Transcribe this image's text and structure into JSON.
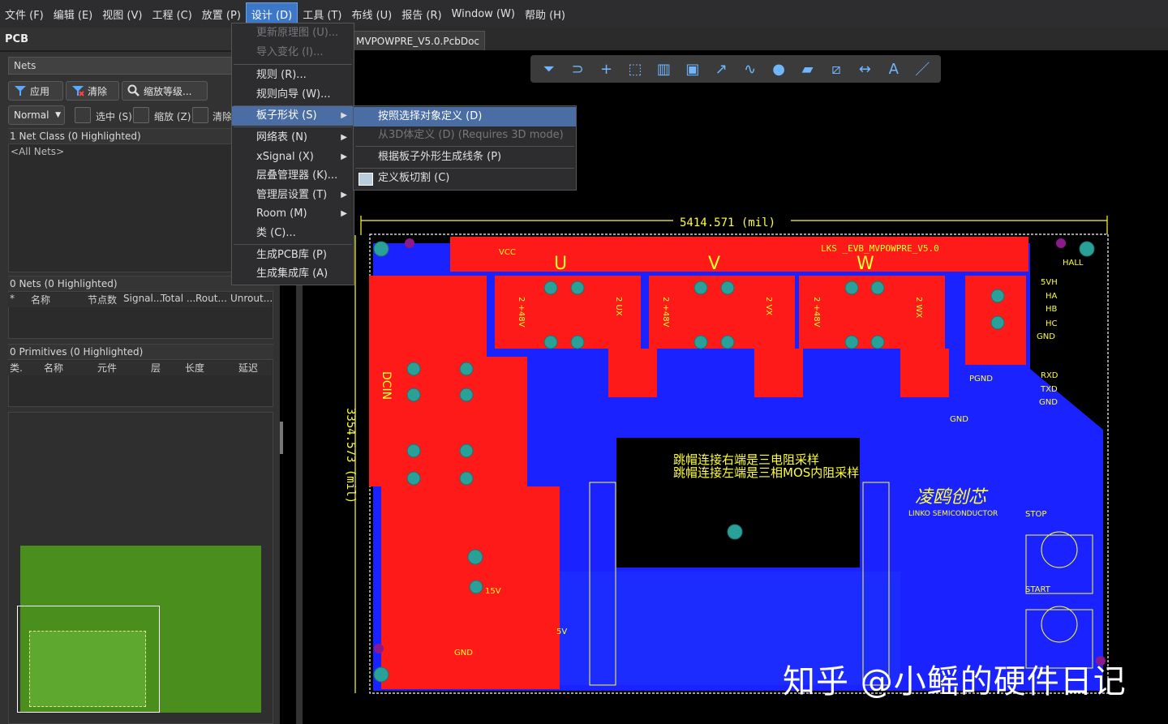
{
  "menubar": {
    "items": [
      "文件 (F)",
      "编辑 (E)",
      "视图 (V)",
      "工程 (C)",
      "放置 (P)",
      "设计 (D)",
      "工具 (T)",
      "布线 (U)",
      "报告 (R)",
      "Window (W)",
      "帮助 (H)"
    ]
  },
  "panel": {
    "title": "PCB",
    "nets_dropdown": "Nets",
    "apply": "应用",
    "clear": "清除",
    "zoom_level": "缩放等级...",
    "mode": "Normal",
    "select": "选中 (S)",
    "zoom": "缩放 (Z)",
    "clear_short": "清除",
    "net_class_header": "1 Net Class (0 Highlighted)",
    "all_nets": "<All Nets>",
    "nets_header": "0 Nets (0 Highlighted)",
    "nets_cols": [
      "*",
      "名称",
      "节点数",
      "Signal...",
      "Total ...",
      "Rout...",
      "Unrout..."
    ],
    "prim_header": "0 Primitives (0 Highlighted)",
    "prim_cols": [
      "类.",
      "名称",
      "元件",
      "层",
      "长度",
      "延迟"
    ]
  },
  "doc_tab": "MVPOWPRE_V5.0.PcbDoc",
  "design_menu": {
    "items": [
      {
        "label": "更新原理图 (U)...",
        "disabled": true
      },
      {
        "label": "导入变化 (I)...",
        "disabled": true
      },
      {
        "label": "规则 (R)...",
        "disabled": false
      },
      {
        "label": "规则向导 (W)...",
        "disabled": false
      },
      {
        "label": "板子形状 (S)",
        "disabled": false,
        "selected": true,
        "submenu": true
      },
      {
        "label": "网络表 (N)",
        "disabled": false,
        "submenu": true
      },
      {
        "label": "xSignal (X)",
        "disabled": false,
        "submenu": true
      },
      {
        "label": "层叠管理器 (K)...",
        "disabled": false
      },
      {
        "label": "管理层设置 (T)",
        "disabled": false,
        "submenu": true
      },
      {
        "label": "Room (M)",
        "disabled": false,
        "submenu": true
      },
      {
        "label": "类 (C)...",
        "disabled": false
      },
      {
        "label": "生成PCB库 (P)",
        "disabled": false
      },
      {
        "label": "生成集成库 (A)",
        "disabled": false
      }
    ]
  },
  "board_shape_submenu": {
    "items": [
      {
        "label": "按照选择对象定义 (D)",
        "selected": true
      },
      {
        "label": "从3D体定义 (D) (Requires 3D mode)",
        "disabled": true
      },
      {
        "label": "根据板子外形生成线条 (P)"
      },
      {
        "label": "定义板切割 (C)"
      }
    ]
  },
  "pcb": {
    "width_dim": "5414.571 (mil)",
    "height_dim": "3354.573 (mil)",
    "board_title": "LKS _EVB_MVPOWPRE_V5.0",
    "phase_u": "U",
    "phase_v": "V",
    "phase_w": "W",
    "note1": "跳帽连接右端是三电阻采样",
    "note2": "跳帽连接左端是三相MOS内阻采样",
    "vcc": "VCC",
    "hall": "HALL",
    "hall_pins": [
      "5VH",
      "HA",
      "HB",
      "HC",
      "GND"
    ],
    "uart_pins": [
      "RXD",
      "TXD",
      "GND"
    ],
    "pgnd": "PGND",
    "gnd": "GND",
    "dcin": "DCIN",
    "brand_cn": "凌鸥创芯",
    "brand_en": "LINKO SEMICONDUCTOR",
    "stop": "STOP",
    "start": "START",
    "v15": "15V",
    "v5": "5V",
    "mos_labels": [
      "2 +48V",
      "2 UX",
      "2 +48V",
      "2 VX",
      "2 +48V",
      "2 WX"
    ]
  },
  "watermark": "知乎 @小鳐的硬件日记",
  "colors": {
    "top_copper": "#ff1a1a",
    "bottom_copper": "#1a22ff",
    "silkscreen": "#ffff33",
    "pad": "#2aa198",
    "menu_highlight": "#4a6da3"
  }
}
